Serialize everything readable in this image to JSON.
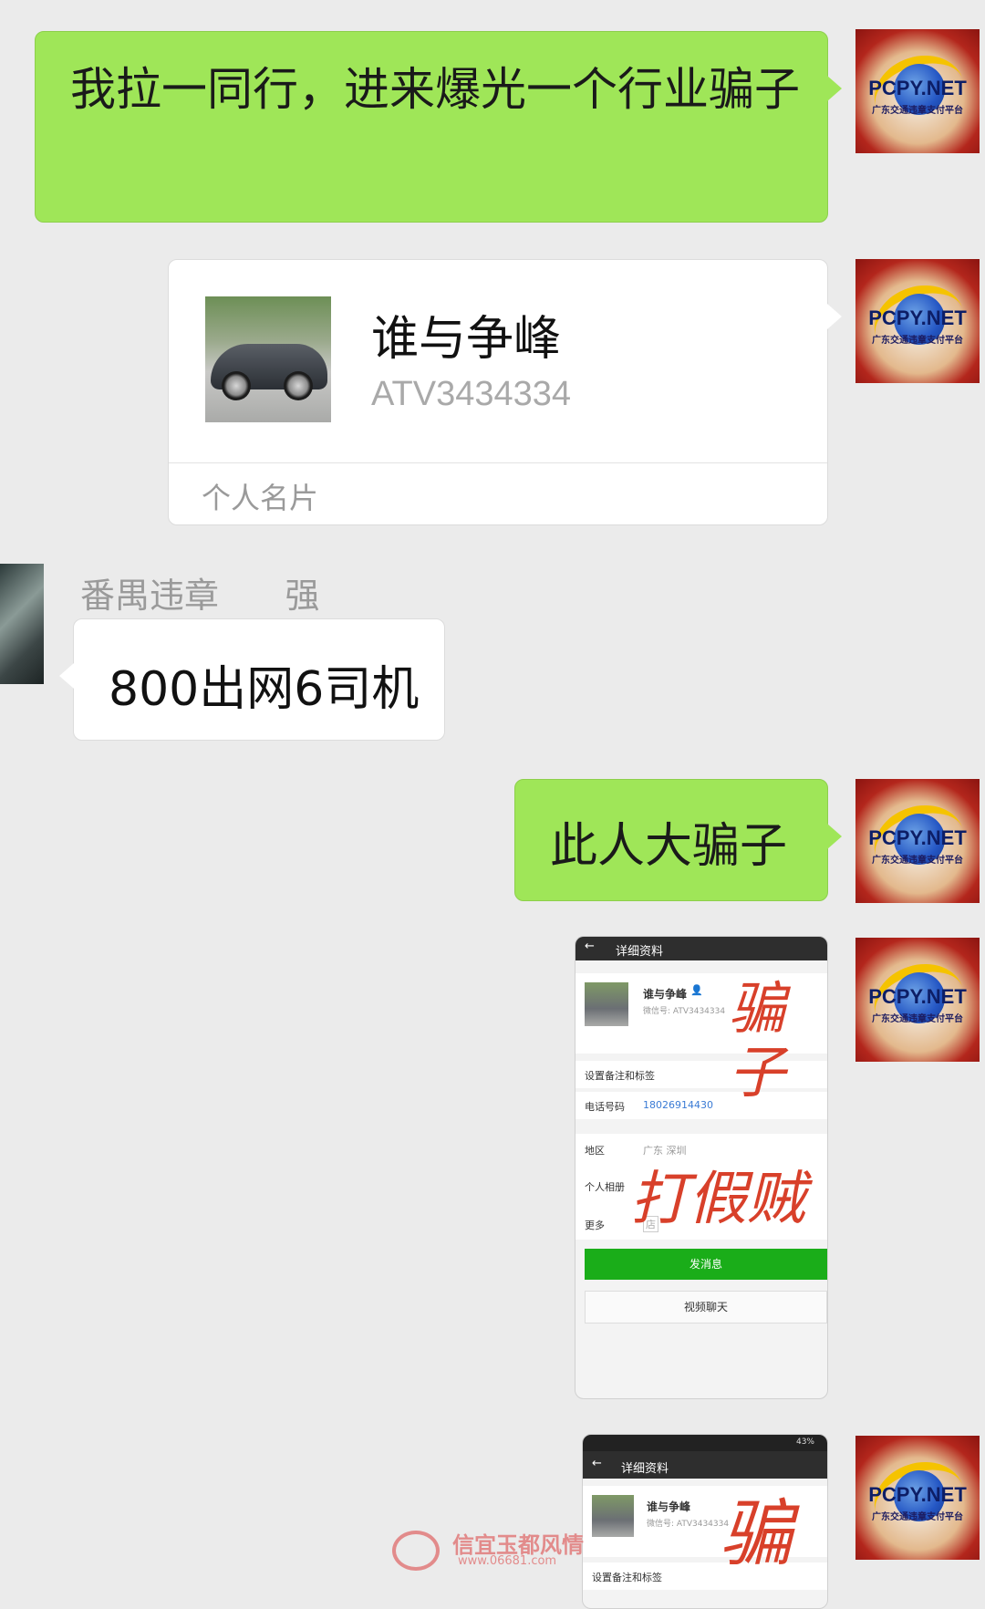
{
  "messages": {
    "m1": {
      "text": "我拉一同行，进来爆光一个行业骗子"
    },
    "card": {
      "name": "谁与争峰",
      "id": "ATV3434334",
      "footer": "个人名片"
    },
    "m3": {
      "sender": "番禺违章      强",
      "text": "800出网6司机"
    },
    "m4": {
      "text": "此人大骗子"
    }
  },
  "avatar": {
    "brand": "PCPY.NET",
    "sub": "广东交通违章支付平台"
  },
  "screenshot1": {
    "title": "详细资料",
    "name": "谁与争峰",
    "wechat_id": "微信号: ATV3434334",
    "remark_label": "设置备注和标签",
    "phone_label": "电话号码",
    "phone": "18026914430",
    "region_label": "地区",
    "region": "广东  深圳",
    "album_label": "个人相册",
    "more_label": "更多",
    "more_icon": "店",
    "send_btn": "发消息",
    "video_btn": "视频聊天",
    "handwriting_1": "骗子",
    "handwriting_2": "打假贼"
  },
  "screenshot2": {
    "status": "43%",
    "title": "详细资料",
    "name": "谁与争峰",
    "wechat_id": "微信号: ATV3434334",
    "remark_label": "设置备注和标签",
    "handwriting": "骗"
  },
  "watermark": {
    "text": "信宜玉都风情",
    "url": "www.06681.com"
  },
  "colors": {
    "bubble_green": "#9fe658",
    "background": "#ebebeb",
    "button_green": "#1aad19",
    "handwriting": "#d8402a"
  }
}
